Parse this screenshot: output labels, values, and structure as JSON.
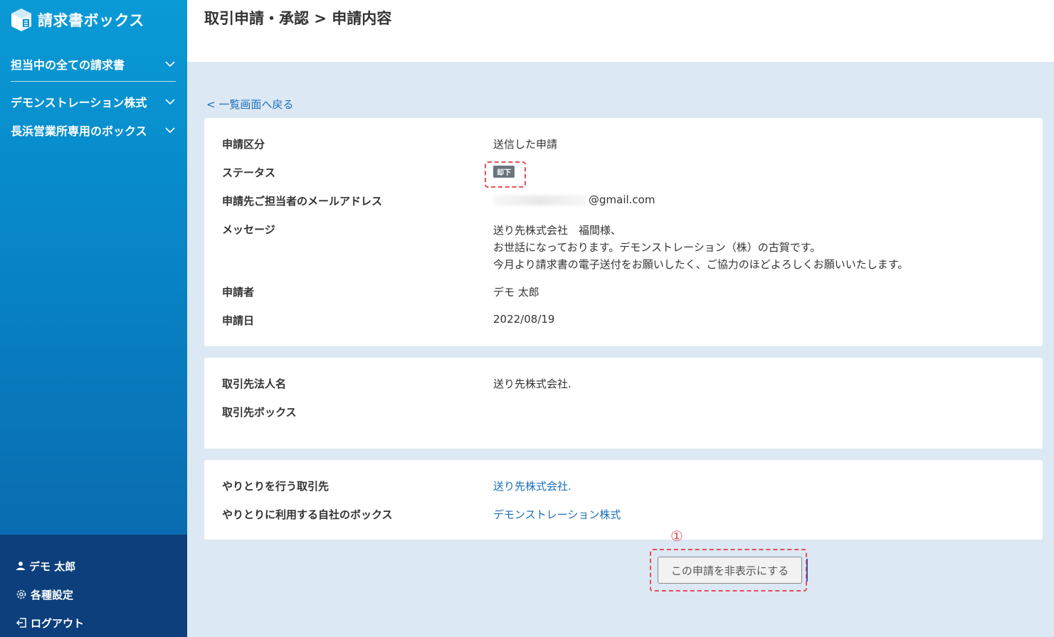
{
  "app": {
    "name": "請求書ボックス"
  },
  "sidebar": {
    "items": [
      {
        "label": "担当中の全ての請求書"
      },
      {
        "label": "デモンストレーション株式"
      },
      {
        "label": "長浜営業所専用のボックス"
      }
    ],
    "user": {
      "name": "デモ 太郎"
    },
    "settings_label": "各種設定",
    "logout_label": "ログアウト"
  },
  "header": {
    "title": "取引申請・承認 > 申請内容"
  },
  "back_link": "< 一覧画面へ戻る",
  "request": {
    "type_label": "申請区分",
    "type_value": "送信した申請",
    "status_label": "ステータス",
    "status_value": "却下",
    "email_label": "申請先ご担当者のメールアドレス",
    "email_value": "@gmail.com",
    "message_label": "メッセージ",
    "message_lines": [
      "送り先株式会社　福間様、",
      "お世話になっております。デモンストレーション（株）の古賀です。",
      "今月より請求書の電子送付をお願いしたく、ご協力のほどよろしくお願いいたします。"
    ],
    "applicant_label": "申請者",
    "applicant_value": "デモ 太郎",
    "date_label": "申請日",
    "date_value": "2022/08/19"
  },
  "partner": {
    "corp_label": "取引先法人名",
    "corp_value": "送り先株式会社.",
    "box_label": "取引先ボックス",
    "box_value": ""
  },
  "exchange": {
    "partner_label": "やりとりを行う取引先",
    "partner_value": "送り先株式会社.",
    "own_box_label": "やりとりに利用する自社のボックス",
    "own_box_value": "デモンストレーション株式"
  },
  "annotation": {
    "marker": "①"
  },
  "hide_button": "この申請を非表示にする",
  "colors": {
    "link": "#1d6fb8",
    "badge": "#6c757d",
    "highlight": "#e0505c",
    "sidebar_bottom": "#0c3f7c"
  }
}
